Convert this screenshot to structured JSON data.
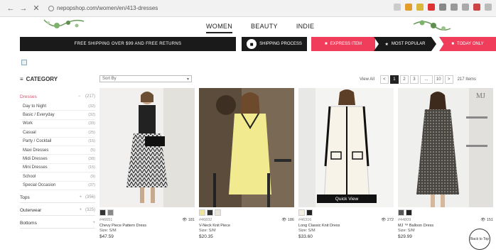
{
  "browser": {
    "url": "nepopshop.com/women/en/413-dresses",
    "back": "←",
    "forward": "→",
    "close": "✕"
  },
  "topnav": {
    "women": "WOMEN",
    "beauty": "BEAUTY",
    "indie": "INDIE"
  },
  "promo": {
    "main": "FREE SHIPPING OVER $99 AND FREE RETURNS",
    "shipping": "SHIPPING PROCESS",
    "express": "EXPRESS ITEM",
    "popular": "MOST POPULAR",
    "today": "TODAY ONLY"
  },
  "sidebar": {
    "title": "CATEGORY",
    "parent": {
      "label": "Dresses",
      "sign": "−",
      "count": "(217)"
    },
    "subitems": [
      {
        "label": "Day to Night",
        "count": "(32)"
      },
      {
        "label": "Basic / Everyday",
        "count": "(32)"
      },
      {
        "label": "Work",
        "count": "(39)"
      },
      {
        "label": "Casual",
        "count": "(25)"
      },
      {
        "label": "Party / Cocktail",
        "count": "(15)"
      },
      {
        "label": "Maxi Dresses",
        "count": "(5)"
      },
      {
        "label": "Midi Dresses",
        "count": "(38)"
      },
      {
        "label": "Mini Dresses",
        "count": "(15)"
      },
      {
        "label": "School",
        "count": "(9)"
      },
      {
        "label": "Special Occasion",
        "count": "(37)"
      }
    ],
    "tops": {
      "label": "Tops",
      "sign": "+",
      "count": "(356)"
    },
    "outerwear": {
      "label": "Outerwear",
      "sign": "+",
      "count": "(325)"
    },
    "bottoms": {
      "label": "Bottoms",
      "sign": "+",
      "count": ""
    }
  },
  "toolbar": {
    "sort_label": "Sort By",
    "sort_caret": "▾",
    "view_all": "View All",
    "prev": "<",
    "pages": [
      "1",
      "2",
      "3",
      "...",
      "10"
    ],
    "next": ">",
    "items": "217 Items"
  },
  "products": [
    {
      "code": "#46651",
      "views": "181",
      "name": "Chevy Piece Pattern Dress",
      "size": "Size: S/M",
      "price": "$47.59"
    },
    {
      "code": "#46832",
      "views": "186",
      "name": "V-Neck Knit Piece",
      "size": "Size: S/M",
      "price": "$20.35"
    },
    {
      "code": "#46316",
      "views": "272",
      "name": "Long Classic Knit Dress",
      "size": "Size: S/M",
      "price": "$33.60",
      "quickview": "Quick View"
    },
    {
      "code": "#44809",
      "views": "151",
      "name": "MJ ™ Balloon Dress",
      "size": "Size: S/M",
      "price": "$29.99"
    }
  ],
  "scroll_badge": "Back to Top",
  "colors": {
    "accent_pink": "#ef3d5b",
    "dark": "#1a1a1a",
    "category_active": "#e84a6a"
  }
}
